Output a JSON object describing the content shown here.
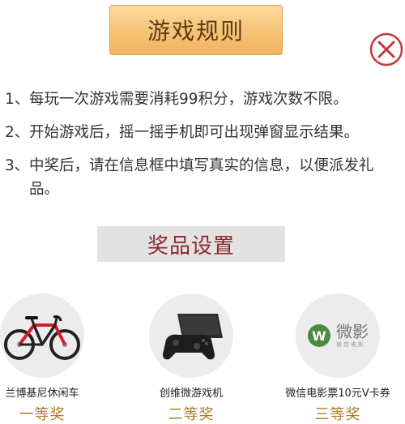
{
  "header": {
    "title": "游戏规则"
  },
  "close_icon": "close-circle-icon",
  "colors": {
    "title_gradient_top": "#fbdca0",
    "title_gradient_bottom": "#f1b35f",
    "close_color": "#c0393b",
    "prize_title_color": "#8b2a2a",
    "prize_level_color": "#b07a2a"
  },
  "rules": [
    {
      "num": "1、",
      "text": "每玩一次游戏需要消耗99积分，游戏次数不限。"
    },
    {
      "num": "2、",
      "text": "开始游戏后，摇一摇手机即可出现弹窗显示结果。"
    },
    {
      "num": "3、",
      "text": "中奖后，请在信息框中填写真实的信息，以便派发礼品。"
    }
  ],
  "prize_section": {
    "title": "奖品设置"
  },
  "prizes": [
    {
      "name": "兰博基尼休闲车",
      "level": "一等奖",
      "icon": "bicycle-icon"
    },
    {
      "name": "创维微游戏机",
      "level": "二等奖",
      "icon": "game-console-icon"
    },
    {
      "name": "微信电影票10元V卡券",
      "level": "三等奖",
      "icon": "weiying-logo-icon",
      "logo_text": "微影",
      "logo_sub": "微信电影"
    }
  ]
}
